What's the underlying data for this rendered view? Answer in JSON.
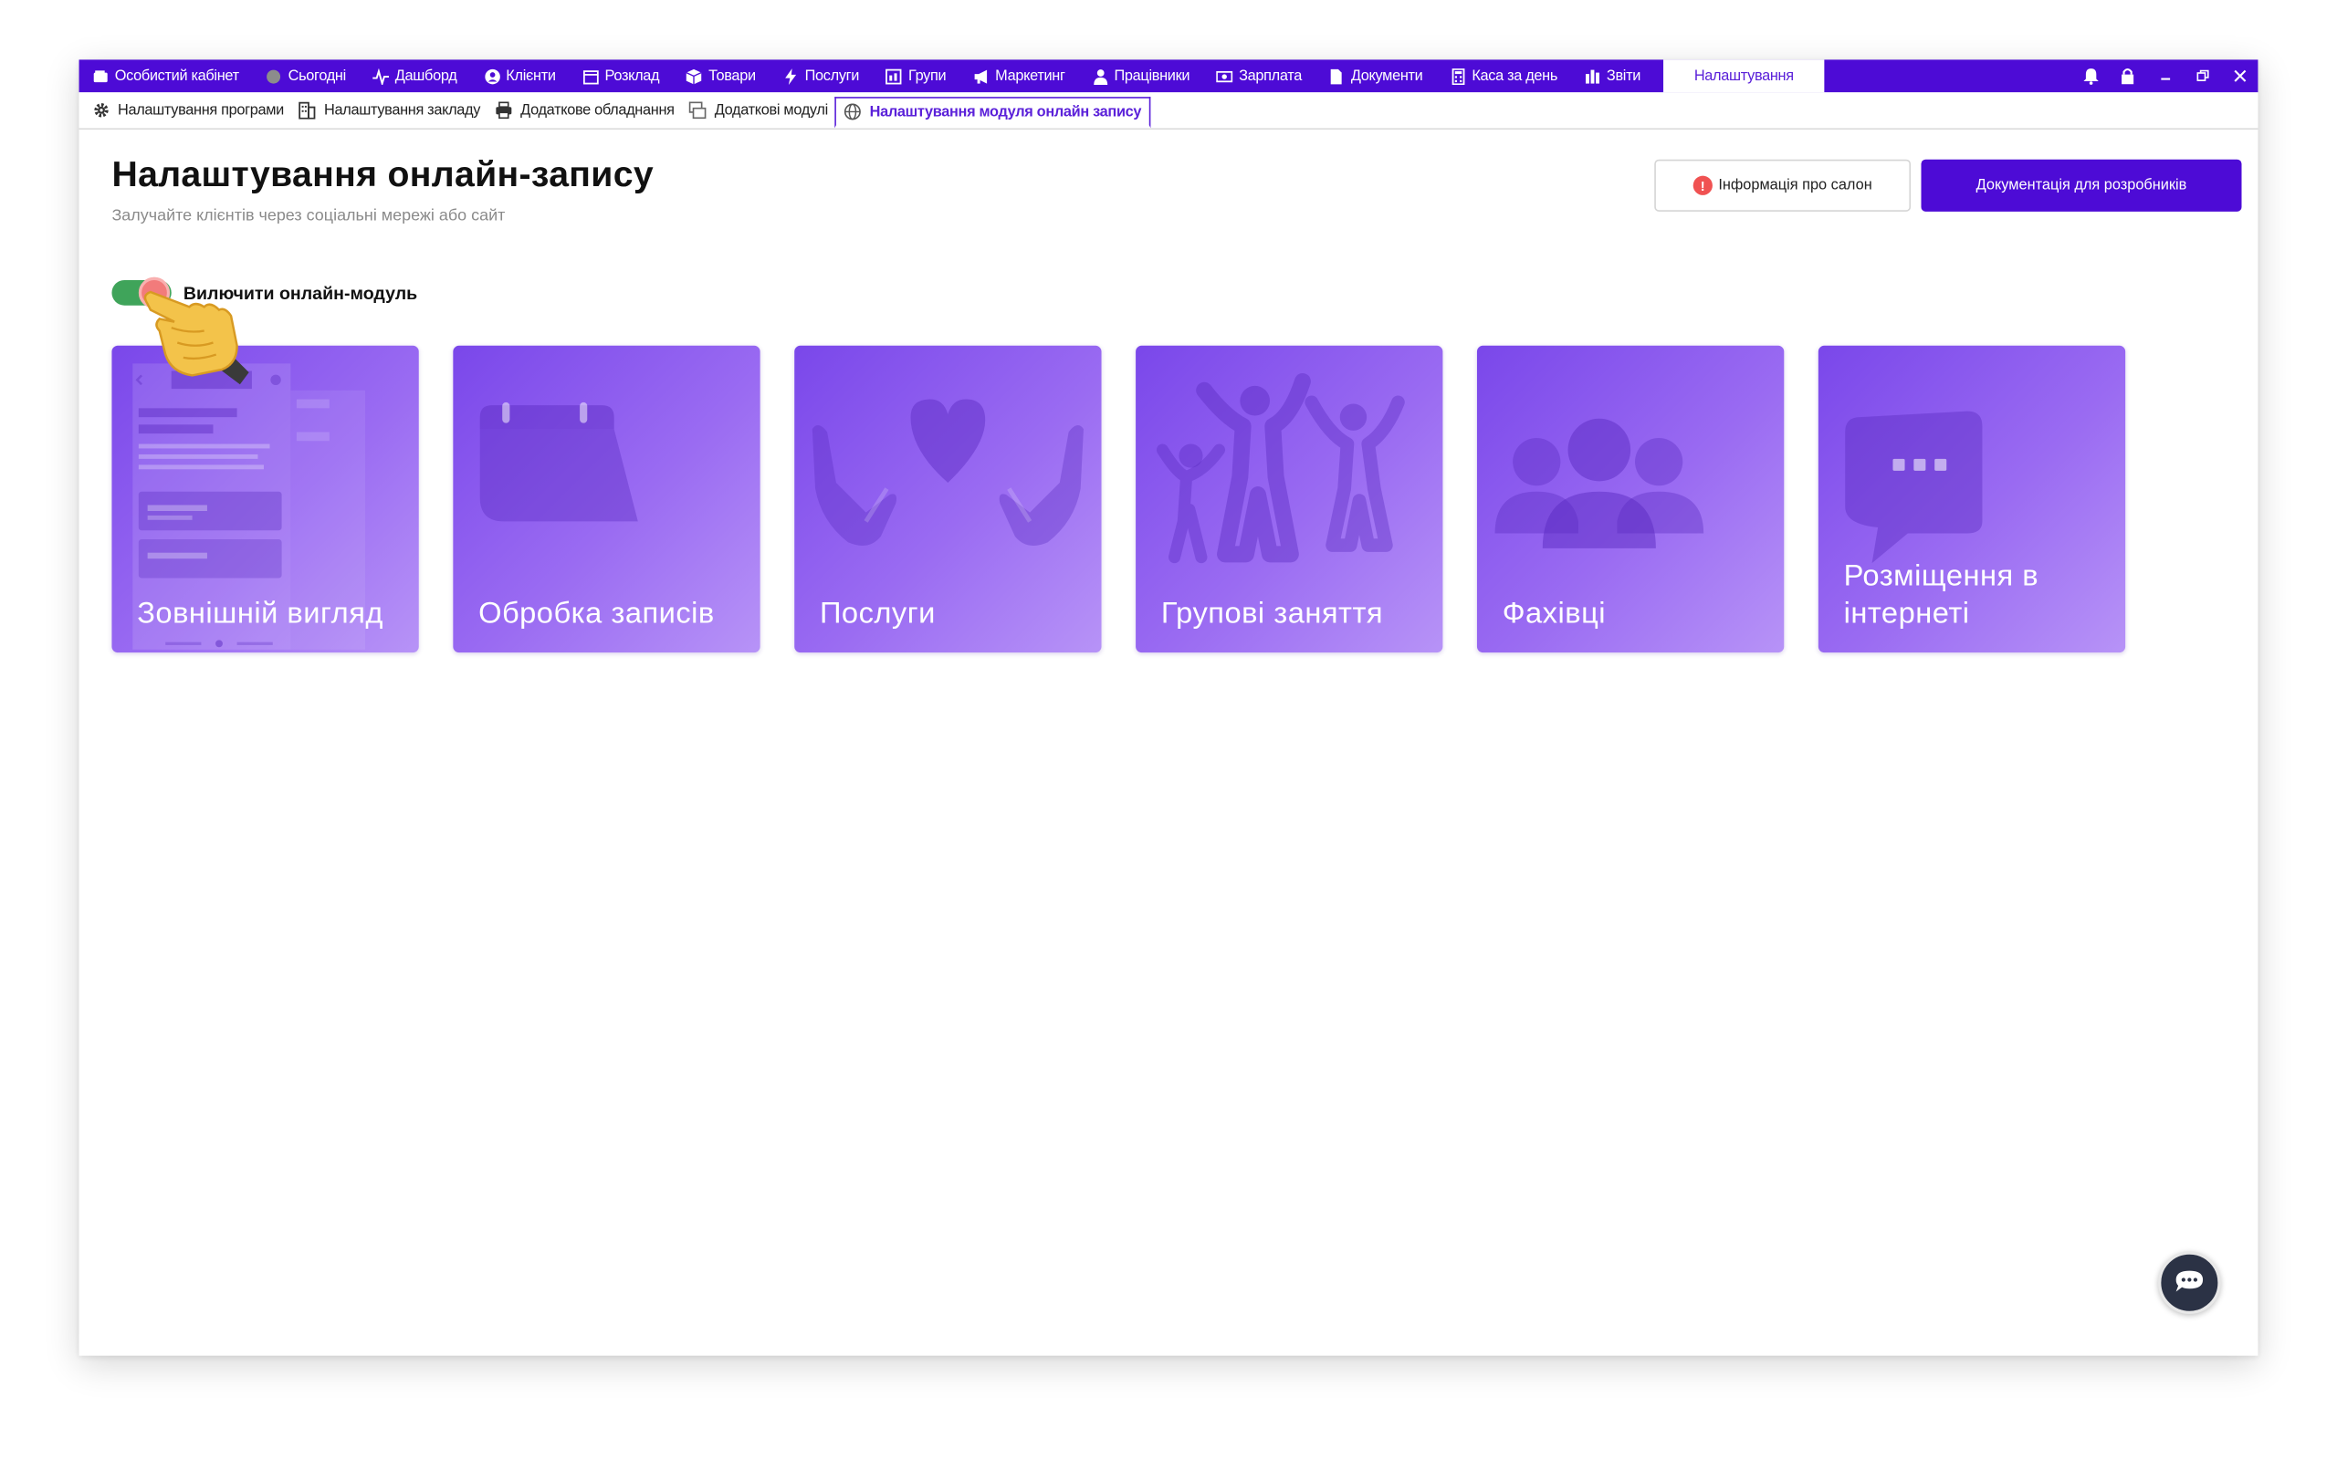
{
  "menubar": {
    "items": [
      {
        "label": "Особистий кабінет",
        "icon": "wallet-icon"
      },
      {
        "label": "Сьогодні",
        "icon": "circle-icon"
      },
      {
        "label": "Дашборд",
        "icon": "pulse-icon"
      },
      {
        "label": "Клієнти",
        "icon": "user-circle-icon"
      },
      {
        "label": "Розклад",
        "icon": "calendar-icon"
      },
      {
        "label": "Товари",
        "icon": "box-icon"
      },
      {
        "label": "Послуги",
        "icon": "bolt-icon"
      },
      {
        "label": "Групи",
        "icon": "group-board-icon"
      },
      {
        "label": "Маркетинг",
        "icon": "megaphone-icon"
      },
      {
        "label": "Працівники",
        "icon": "person-icon"
      },
      {
        "label": "Зарплата",
        "icon": "banknote-icon"
      },
      {
        "label": "Документи",
        "icon": "document-icon"
      },
      {
        "label": "Каса за день",
        "icon": "calculator-icon"
      },
      {
        "label": "Звіти",
        "icon": "bar-chart-icon"
      }
    ],
    "active_label": "Налаштування"
  },
  "subtabs": {
    "items": [
      {
        "label": "Налаштування програми",
        "icon": "gear-icon"
      },
      {
        "label": "Налаштування закладу",
        "icon": "building-icon"
      },
      {
        "label": "Додаткове обладнання",
        "icon": "printer-icon"
      },
      {
        "label": "Додаткові модулі",
        "icon": "modules-icon"
      }
    ],
    "active_label": "Налаштування модуля онлайн запису"
  },
  "header": {
    "title": "Налаштування онлайн-запису",
    "subtitle": "Залучайте клієнтів через соціальні мережі або сайт",
    "info_button": "Інформація про салон",
    "docs_button": "Документація для розробників"
  },
  "toggle": {
    "label": "Вилючити онлайн-модуль",
    "on": true
  },
  "cards": [
    {
      "title": "Зовнішній вигляд",
      "icon": "layout-preview-icon"
    },
    {
      "title": "Обробка записів",
      "icon": "calendar-icon"
    },
    {
      "title": "Послуги",
      "icon": "heart-hands-icon"
    },
    {
      "title": "Групові заняття",
      "icon": "jumping-people-icon"
    },
    {
      "title": "Фахівці",
      "icon": "team-icon"
    },
    {
      "title": "Розміщення в інтернеті",
      "icon": "chat-bubble-icon"
    }
  ],
  "colors": {
    "brand": "#4d0bd6",
    "toggle_on": "#3fa45a",
    "warn": "#f05252"
  }
}
